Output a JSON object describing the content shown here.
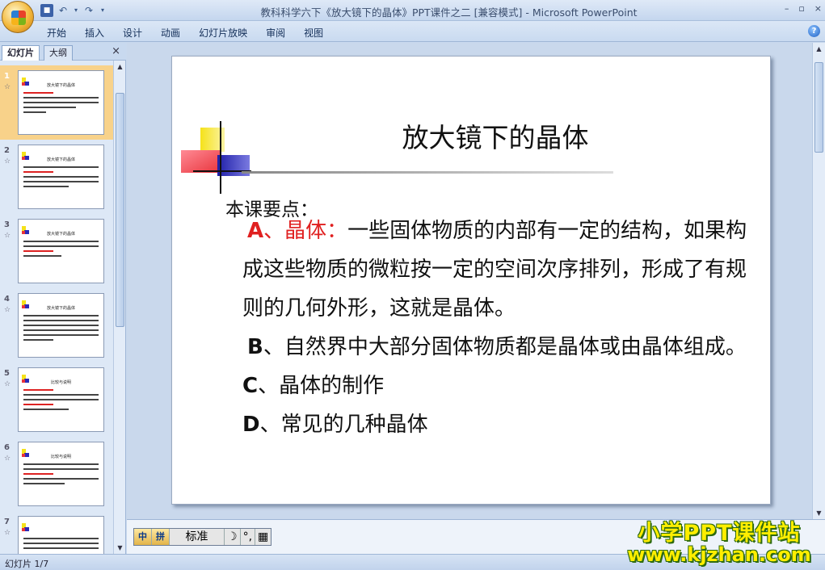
{
  "window": {
    "title": "教科科学六下《放大镜下的晶体》PPT课件之二 [兼容模式] - Microsoft PowerPoint",
    "minimize": "–",
    "restore": "▫",
    "close": "×"
  },
  "ribbon": {
    "tabs": [
      "开始",
      "插入",
      "设计",
      "动画",
      "幻灯片放映",
      "审阅",
      "视图"
    ],
    "help": "?"
  },
  "left_panel": {
    "tab_slides": "幻灯片",
    "tab_outline": "大纲",
    "close": "×",
    "thumbnails": [
      {
        "num": "1",
        "star": "☆",
        "title": "放大镜下的晶体"
      },
      {
        "num": "2",
        "star": "☆",
        "title": "放大镜下的晶体"
      },
      {
        "num": "3",
        "star": "☆",
        "title": "放大镜下的晶体"
      },
      {
        "num": "4",
        "star": "☆",
        "title": "放大镜下的晶体"
      },
      {
        "num": "5",
        "star": "☆",
        "title": "比较与说明"
      },
      {
        "num": "6",
        "star": "☆",
        "title": "比较与说明"
      },
      {
        "num": "7",
        "star": "☆",
        "title": ""
      }
    ]
  },
  "slide": {
    "title": "放大镜下的晶体",
    "subtitle": "本课要点：",
    "points": [
      {
        "letter": "A",
        "lead": "、晶体：",
        "text": "一些固体物质的内部有一定的结构，如果构成这些物质的微粒按一定的空间次序排列，形成了有规则的几何外形，这就是晶体。"
      },
      {
        "letter": "B",
        "lead": "",
        "text": "、自然界中大部分固体物质都是晶体或由晶体组成。"
      },
      {
        "letter": "C",
        "lead": "",
        "text": "、晶体的制作"
      },
      {
        "letter": "D",
        "lead": "",
        "text": "、常见的几种晶体"
      }
    ]
  },
  "ime": {
    "mode": "标准",
    "moon": "☽",
    "punct": "°,",
    "keyboard": "▦"
  },
  "status": {
    "slide_indicator": "幻灯片 1/7"
  },
  "watermark": {
    "line1": "小学PPT课件站",
    "line2": "www.kjzhan.com"
  },
  "colors": {
    "accent_red": "#e02020",
    "selected_thumb": "#f8d28a",
    "deco_yellow": "#f5e21a",
    "deco_blue": "#2a2ab8",
    "deco_red": "#e8333a"
  }
}
